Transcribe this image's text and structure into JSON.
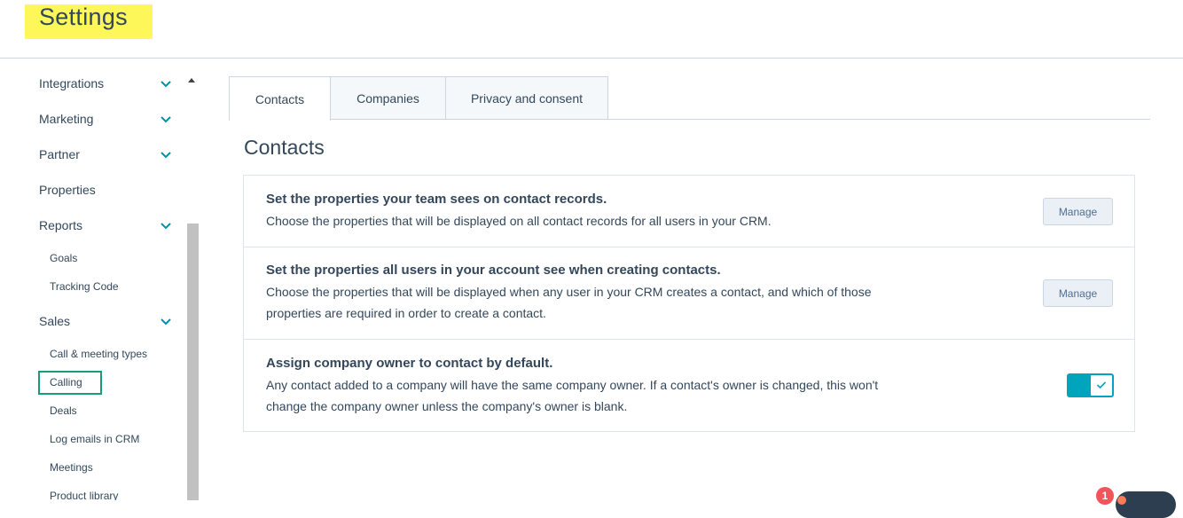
{
  "header": {
    "title": "Settings"
  },
  "sidebar": {
    "items": [
      {
        "label": "Integrations",
        "expandable": true
      },
      {
        "label": "Marketing",
        "expandable": true
      },
      {
        "label": "Partner",
        "expandable": true
      },
      {
        "label": "Properties",
        "expandable": false
      },
      {
        "label": "Reports",
        "expandable": true
      },
      {
        "label": "Sales",
        "expandable": true
      }
    ],
    "reports_children": [
      "Goals",
      "Tracking Code"
    ],
    "sales_children": [
      "Call & meeting types",
      "Calling",
      "Deals",
      "Log emails in CRM",
      "Meetings",
      "Product library"
    ],
    "highlighted_item": "Calling"
  },
  "tabs": [
    {
      "label": "Contacts",
      "active": true
    },
    {
      "label": "Companies",
      "active": false
    },
    {
      "label": "Privacy and consent",
      "active": false
    }
  ],
  "section": {
    "title": "Contacts"
  },
  "rows": [
    {
      "title": "Set the properties your team sees on contact records.",
      "description": "Choose the properties that will be displayed on all contact records for all users in your CRM.",
      "action_label": "Manage"
    },
    {
      "title": "Set the properties all users in your account see when creating contacts.",
      "description_line1": "Choose the properties that will be displayed when any user in your CRM creates a contact, and which of those",
      "description_line2": "properties are required in order to create a contact.",
      "action_label": "Manage"
    },
    {
      "title": "Assign company owner to contact by default.",
      "description_line1": "Any contact added to a company will have the same company owner. If a contact's owner is changed, this won't",
      "description_line2": "change the company owner unless the company's owner is blank.",
      "toggle_on": true
    }
  ],
  "chat": {
    "badge_count": "1"
  },
  "colors": {
    "accent": "#00a4bd",
    "highlight": "#fdf75a",
    "focus_box": "#1a9b7c",
    "text": "#33475b"
  }
}
